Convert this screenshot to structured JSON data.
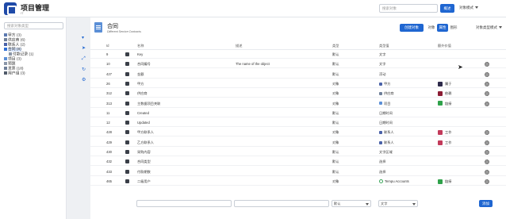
{
  "app": {
    "title": "项目管理",
    "subtitle": "IT"
  },
  "topbar": {
    "search_placeholder": "搜索对象",
    "overview_label": "概述",
    "mode_label": "对象模式"
  },
  "sidebar": {
    "search_placeholder": "搜索对象类型",
    "items": [
      {
        "label": "甲方 (3)",
        "color": "#5b79b0"
      },
      {
        "label": "供应商 (6)",
        "color": "#6e7f99"
      },
      {
        "label": "联系人 (2)",
        "color": "#4a62a8"
      },
      {
        "label": "合同 (8)",
        "color": "#2f6fd6",
        "selected": true
      },
      {
        "label": "付款记录 (1)",
        "color": "#8a96a8",
        "child": true
      },
      {
        "label": "项目 (3)",
        "color": "#5b8fd6"
      },
      {
        "label": "预算",
        "color": "#8a96a8"
      },
      {
        "label": "发票 (18)",
        "color": "#6e7f99"
      },
      {
        "label": "用户组 (3)",
        "color": "#4f5a6a"
      }
    ]
  },
  "object": {
    "title": "合同",
    "subtitle": "Different Service Contracts"
  },
  "header_buttons": {
    "create": "创建对象",
    "objects": "对象",
    "properties": "属性",
    "graph": "图形",
    "type_mode": "对象类型模式"
  },
  "table": {
    "columns": {
      "id": "Id",
      "name": "名称",
      "description": "描述",
      "type": "类型",
      "value_type": "类型值",
      "extra": "额外价值"
    },
    "rows": [
      {
        "id": "9",
        "name": "Key",
        "desc": "",
        "type": "默认",
        "value": "文字",
        "extra": "",
        "gear": false
      },
      {
        "id": "10",
        "name": "合同编号",
        "desc": "The name of the object",
        "type": "默认",
        "value": "文字",
        "extra": "",
        "gear": true
      },
      {
        "id": "427",
        "name": "金额",
        "desc": "",
        "type": "默认",
        "value": "浮动",
        "extra": "",
        "gear": true
      },
      {
        "id": "26",
        "name": "甲方",
        "desc": "",
        "type": "对象",
        "value": "甲方",
        "value_icon": "#4a62a8",
        "extra": "属于",
        "extra_color": "#2d2a4a",
        "gear": true
      },
      {
        "id": "312",
        "name": "供应商",
        "desc": "",
        "type": "对象",
        "value": "供应商",
        "value_icon": "#6e7f99",
        "extra": "依赖",
        "extra_color": "#8b1c34",
        "gear": true
      },
      {
        "id": "313",
        "name": "主数据项目关联",
        "desc": "",
        "type": "对象",
        "value": "项目",
        "value_icon": "#5b8fd6",
        "extra": "链接",
        "extra_color": "#2fa14a",
        "gear": true
      },
      {
        "id": "11",
        "name": "Created",
        "desc": "",
        "type": "默认",
        "value": "日期时间",
        "extra": "",
        "gear": false
      },
      {
        "id": "12",
        "name": "Updated",
        "desc": "",
        "type": "默认",
        "value": "日期时间",
        "extra": "",
        "gear": false
      },
      {
        "id": "428",
        "name": "甲方联系人",
        "desc": "",
        "type": "对象",
        "value": "联系人",
        "value_icon": "#4a62a8",
        "extra": "工作",
        "extra_color": "#c23a5a",
        "gear": true
      },
      {
        "id": "429",
        "name": "乙方联系人",
        "desc": "",
        "type": "对象",
        "value": "联系人",
        "value_icon": "#4a62a8",
        "extra": "工作",
        "extra_color": "#c23a5a",
        "gear": true
      },
      {
        "id": "430",
        "name": "采购内容",
        "desc": "",
        "type": "默认",
        "value": "文字区域",
        "extra": "",
        "gear": true
      },
      {
        "id": "432",
        "name": "合同类型",
        "desc": "",
        "type": "默认",
        "value": "选择",
        "extra": "",
        "gear": true
      },
      {
        "id": "433",
        "name": "付款期数",
        "desc": "",
        "type": "默认",
        "value": "选择",
        "extra": "",
        "gear": true
      },
      {
        "id": "465",
        "name": "二级用户",
        "desc": "",
        "type": "对象",
        "value": "Tempu Accounts",
        "value_icon": "tempo",
        "extra": "链接",
        "extra_color": "#2fa14a",
        "gear": true
      }
    ],
    "footer": {
      "type_value": "默认",
      "value_value": "文字",
      "add_label": "添加"
    }
  }
}
